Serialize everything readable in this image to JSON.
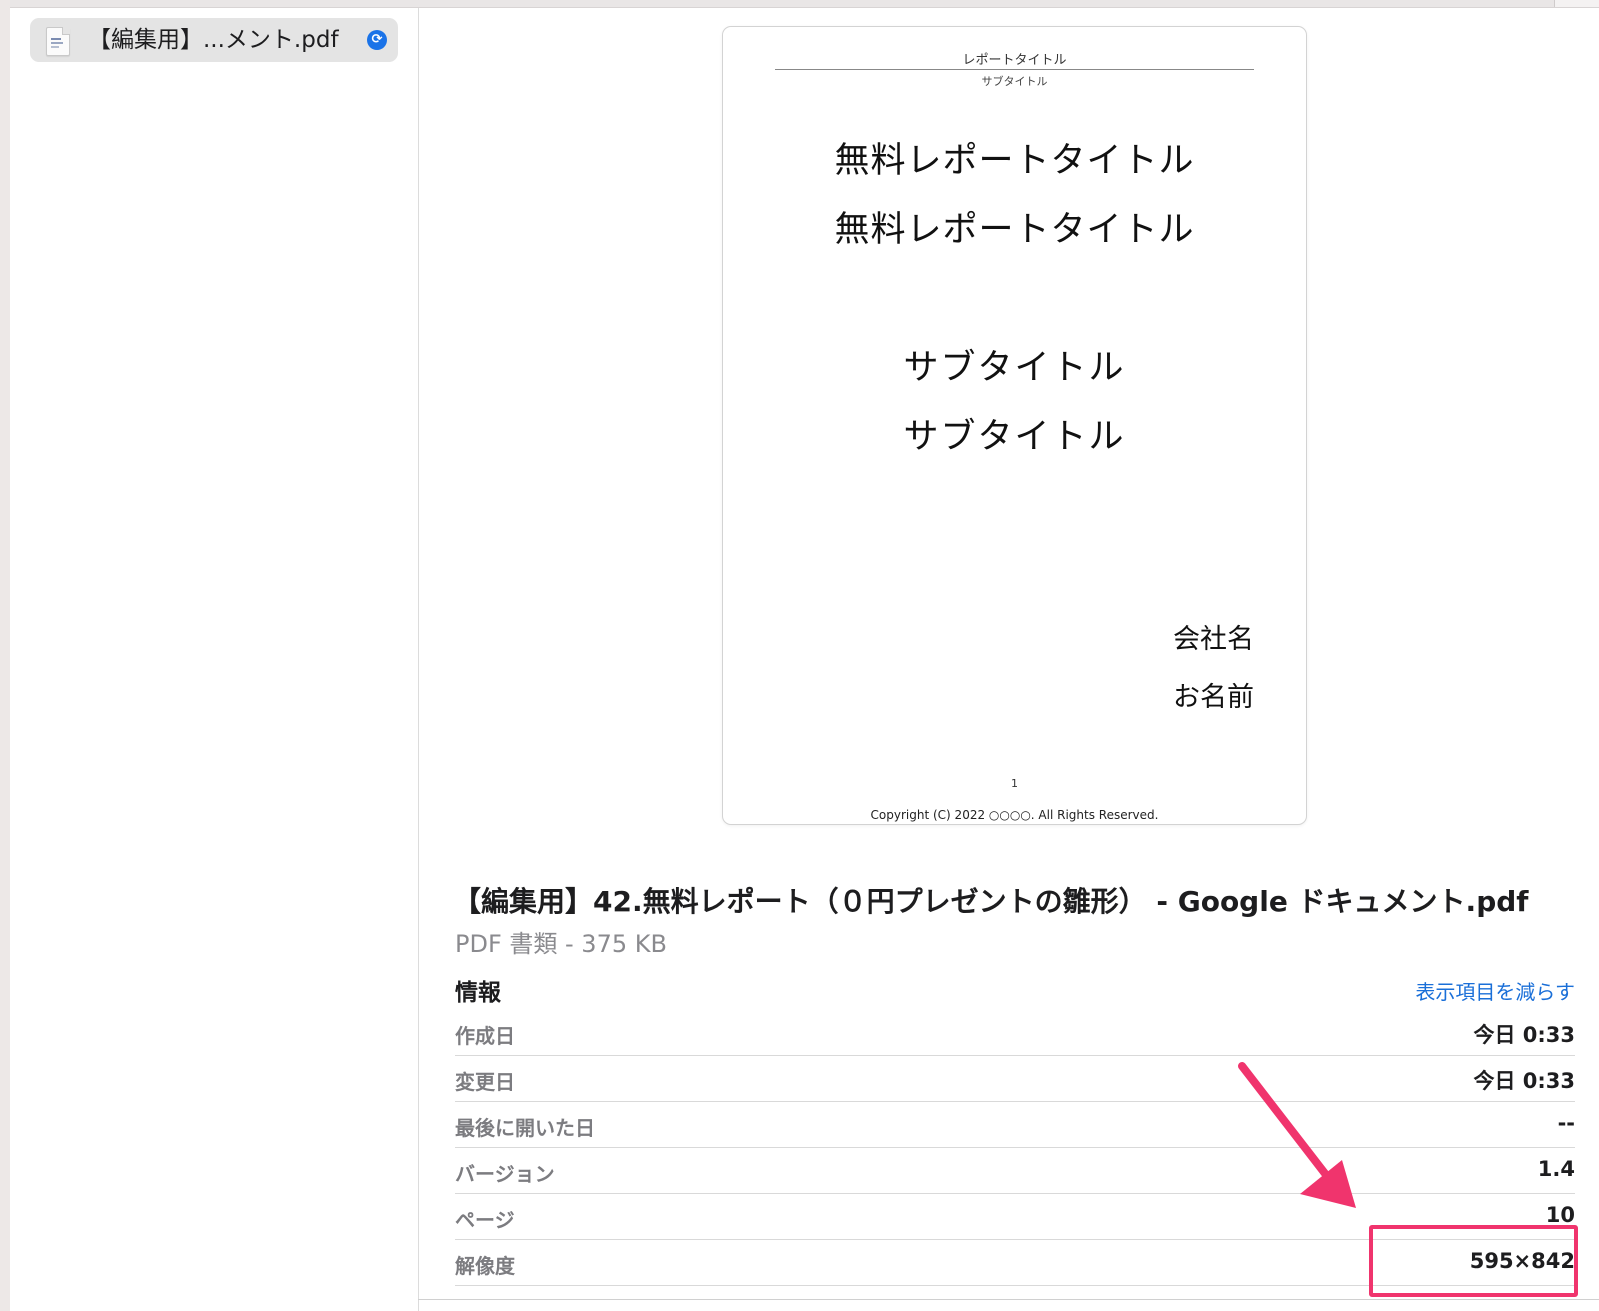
{
  "sidebar": {
    "file_item": {
      "name": "【編集用】...メント.pdf",
      "status_icon": "sync-icon"
    }
  },
  "preview": {
    "header_title": "レポートタイトル",
    "header_subtitle": "サブタイトル",
    "titles": [
      "無料レポートタイトル",
      "無料レポートタイトル"
    ],
    "subtitles": [
      "サブタイトル",
      "サブタイトル"
    ],
    "company": "会社名",
    "author": "お名前",
    "page_number": "1",
    "copyright": "Copyright (C) 2022 ○○○○. All Rights Reserved."
  },
  "document": {
    "title": "【編集用】42.無料レポート（０円プレゼントの雛形） - Google ドキュメント.pdf",
    "kind_size": "PDF 書類 - 375 KB"
  },
  "info": {
    "heading": "情報",
    "show_less": "表示項目を減らす",
    "rows": [
      {
        "label": "作成日",
        "value": "今日 0:33"
      },
      {
        "label": "変更日",
        "value": "今日 0:33"
      },
      {
        "label": "最後に開いた日",
        "value": "--"
      },
      {
        "label": "バージョン",
        "value": "1.4"
      },
      {
        "label": "ページ",
        "value": "10"
      },
      {
        "label": "解像度",
        "value": "595×842"
      }
    ]
  },
  "annotation": {
    "color": "#f0346d",
    "target": "解像度"
  }
}
